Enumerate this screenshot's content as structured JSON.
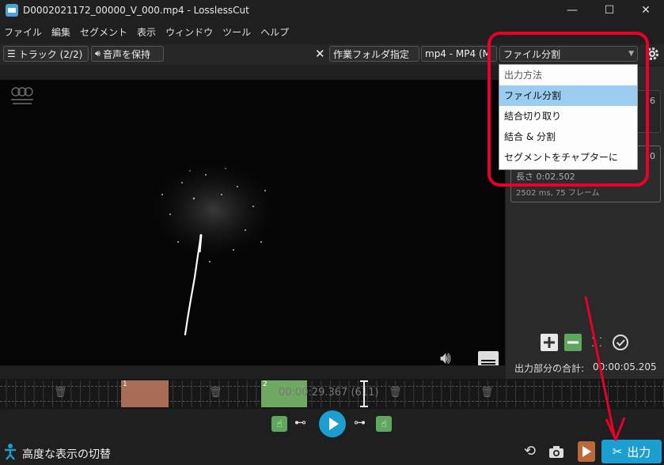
{
  "window": {
    "title": "D0002021172_00000_V_000.mp4 - LosslessCut",
    "minimize": "—",
    "maximize": "☐",
    "close": "✕"
  },
  "menu": [
    "ファイル",
    "編集",
    "セグメント",
    "表示",
    "ウィンドウ",
    "ツール",
    "ヘルプ"
  ],
  "toolbar": {
    "tracks_label": "トラック (2/2)",
    "keep_audio_label": "音声を保持",
    "close_symbol": "✕",
    "working_folder_label": "作業フォルダ指定",
    "format_label": "mp4 - MP4 (M",
    "export_mode_selected": "ファイル分割"
  },
  "dropdown": {
    "header": "出力方法",
    "options": [
      "ファイル分割",
      "結合切り取り",
      "結合 & 分割",
      "セグメントをチャプターに"
    ],
    "highlighted_index": 0
  },
  "segment_panel": {
    "partial_digit": "6",
    "partial_digit2": "0",
    "length_label": "長さ 0:02.502",
    "partial_line": "2502 ms, 75 フレーム",
    "total_label": "出力部分の合計:",
    "total_value": "00:00:05.205"
  },
  "timeline": {
    "current_time": "00:00:29.367 (611)",
    "segments": [
      {
        "label": "1",
        "color": "#a86d56"
      },
      {
        "label": "2",
        "color": "#6fa860"
      }
    ]
  },
  "bottom": {
    "toggle_label": "高度な表示の切替",
    "export_label": "出力"
  },
  "colors": {
    "accent": "#1c9fd0",
    "highlight": "#9acdf0",
    "redbox": "#e8002a",
    "arrow": "#e8002a"
  }
}
